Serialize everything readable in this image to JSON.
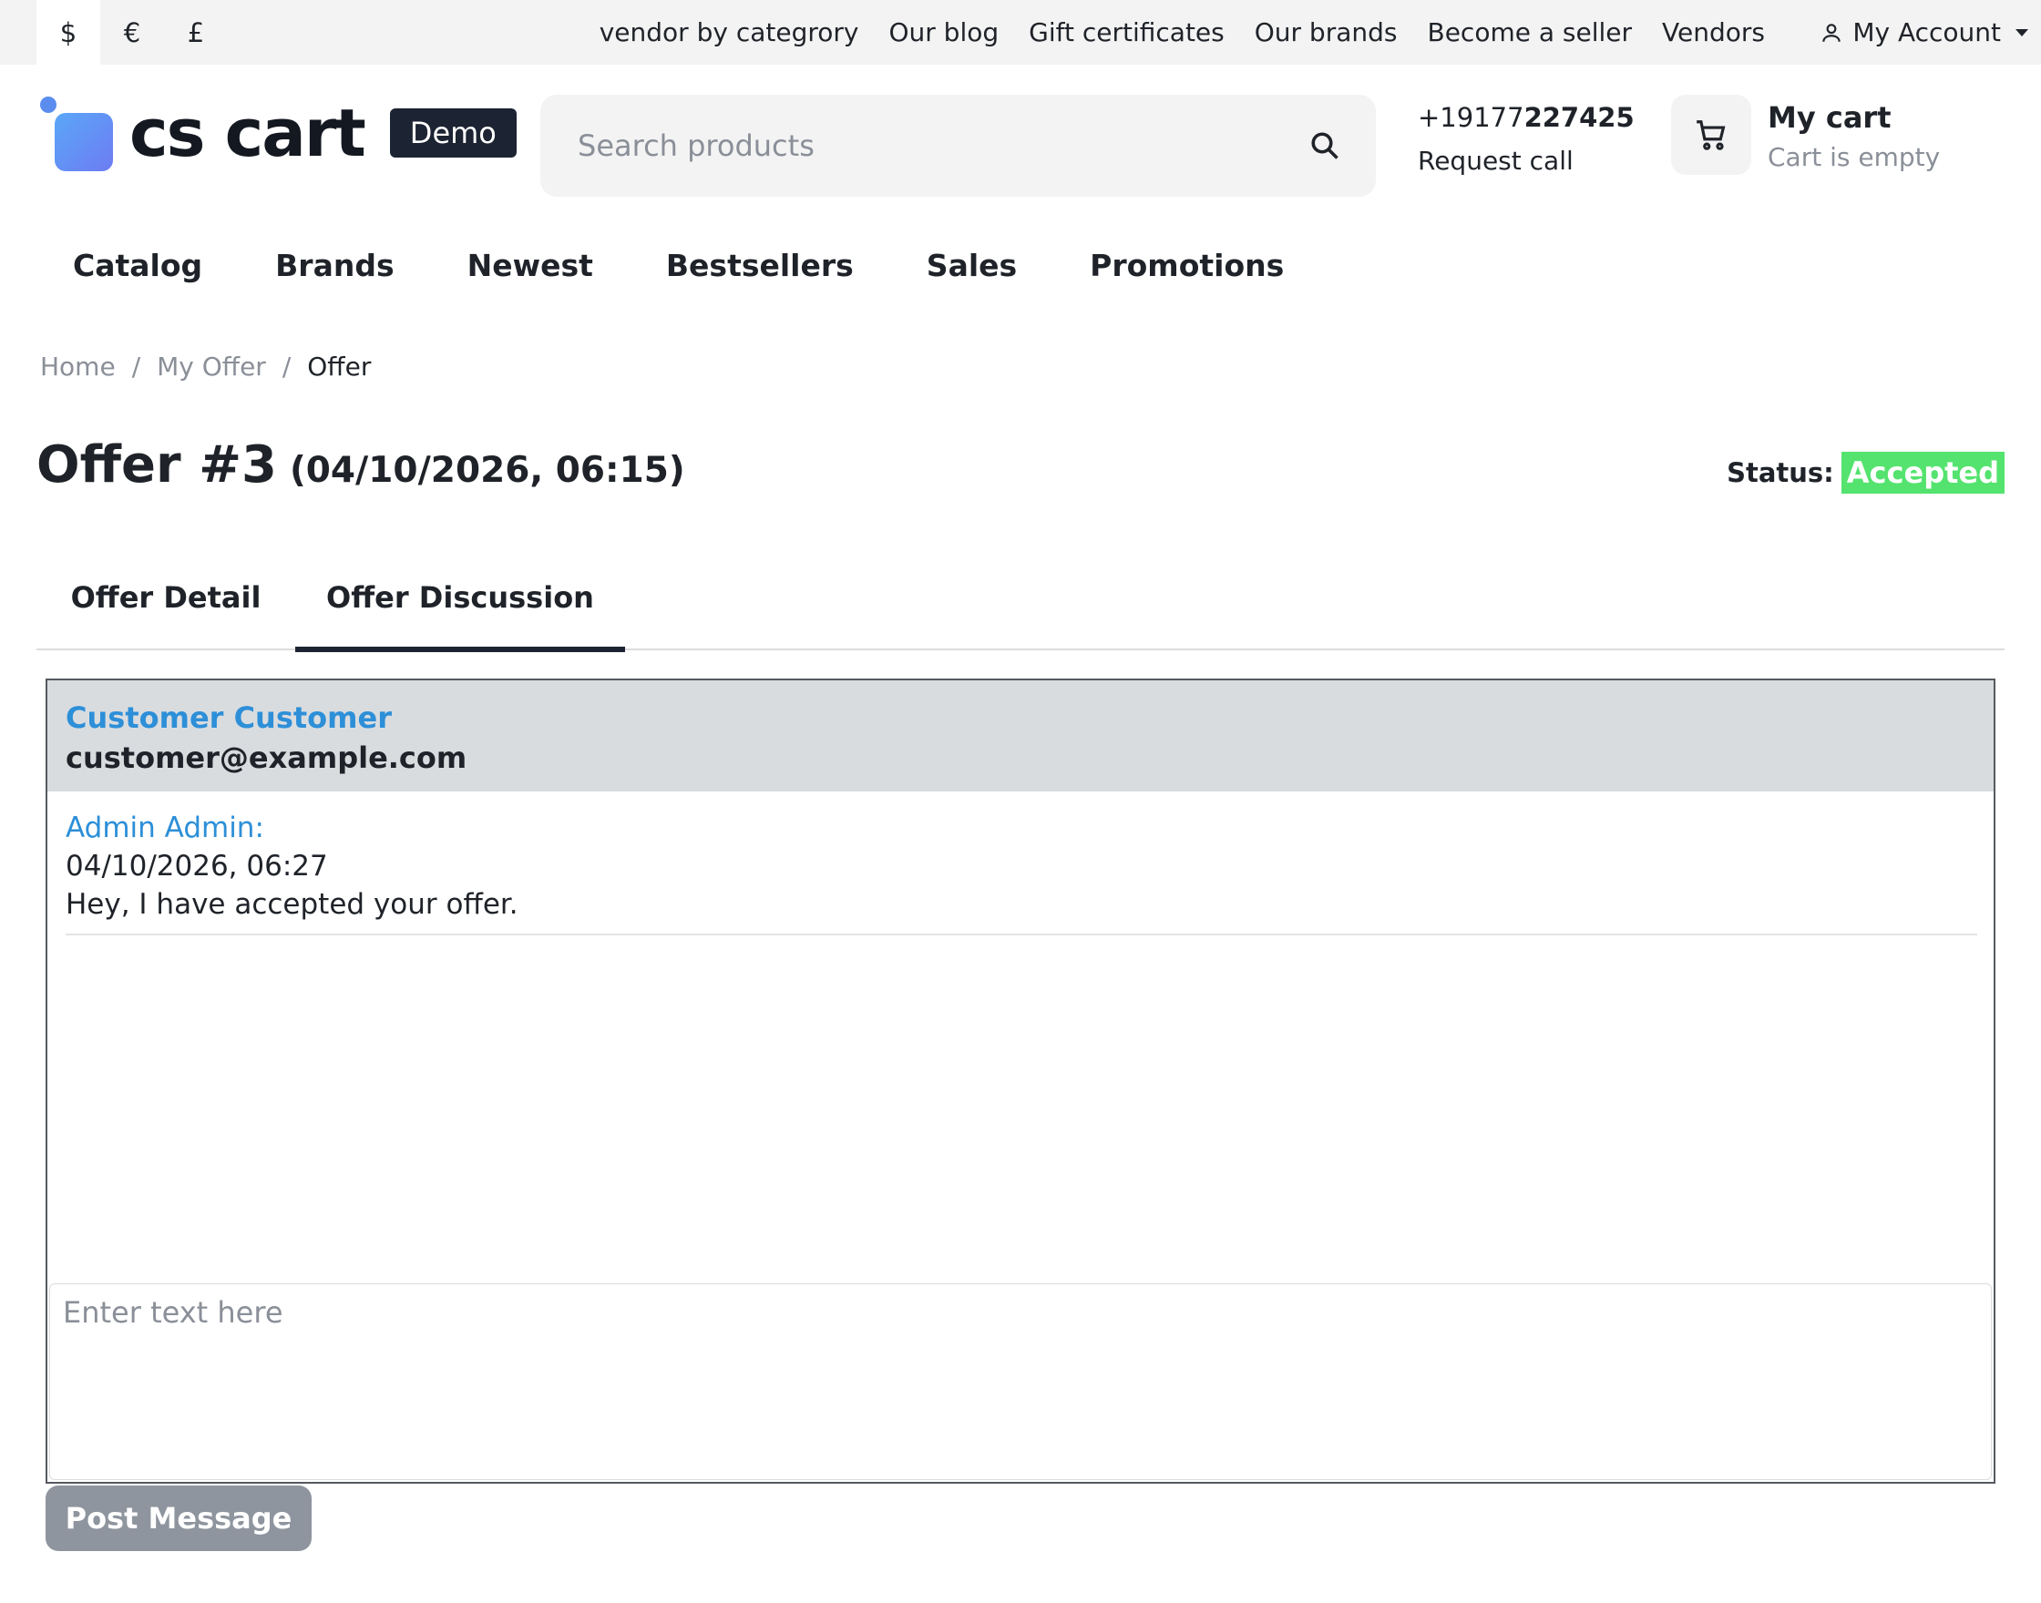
{
  "topbar": {
    "currencies": [
      "$",
      "€",
      "£"
    ],
    "links": [
      "vendor by categrory",
      "Our blog",
      "Gift certificates",
      "Our brands",
      "Become a seller",
      "Vendors"
    ],
    "account_label": "My Account"
  },
  "header": {
    "logo_text": "cs cart",
    "demo_badge": "Demo",
    "search_placeholder": "Search products",
    "phone_prefix": "+19177",
    "phone_bold": "227425",
    "request_call": "Request call",
    "cart_title": "My cart",
    "cart_status": "Cart is empty"
  },
  "nav": [
    "Catalog",
    "Brands",
    "Newest",
    "Bestsellers",
    "Sales",
    "Promotions"
  ],
  "breadcrumb": {
    "items": [
      "Home",
      "My Offer"
    ],
    "separator": "/",
    "current": "Offer"
  },
  "offer": {
    "title": "Offer #3",
    "date": "(04/10/2026, 06:15)",
    "status_label": "Status:",
    "status_value": "Accepted",
    "status_color": "#54e36e"
  },
  "tabs": [
    "Offer Detail",
    "Offer Discussion"
  ],
  "discussion": {
    "customer_name": "Customer Customer",
    "customer_email": "customer@example.com",
    "messages": [
      {
        "author": "Admin Admin:",
        "date": "04/10/2026, 06:27",
        "text": "Hey, I have accepted your offer."
      }
    ],
    "input_placeholder": "Enter text here",
    "post_button": "Post Message"
  },
  "icons": {
    "search": "search-icon",
    "cart": "cart-icon",
    "account": "user-icon",
    "caret": "chevron-down-icon"
  }
}
